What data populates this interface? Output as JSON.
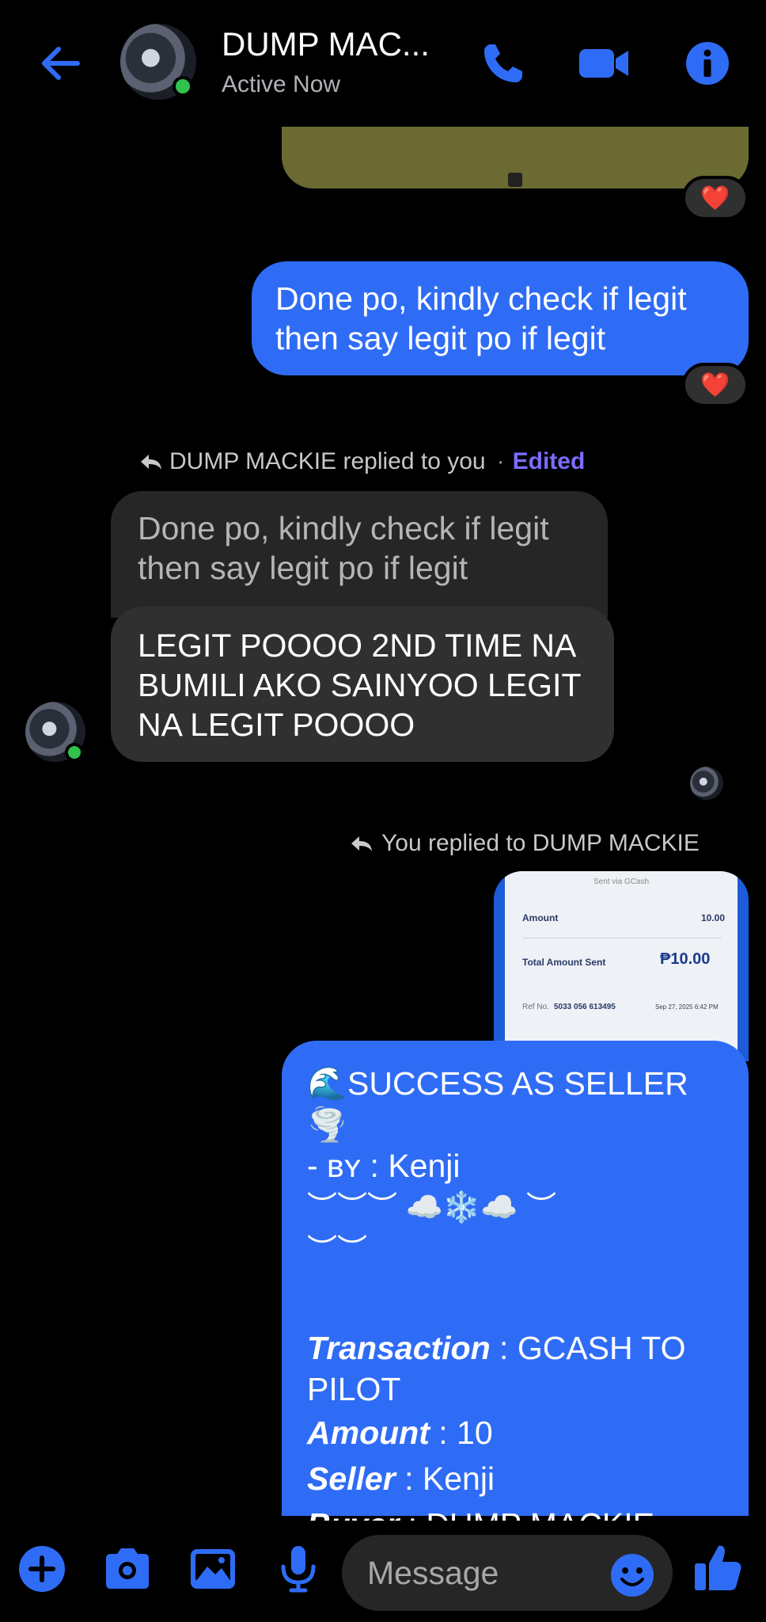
{
  "header": {
    "title": "DUMP MAC...",
    "status": "Active Now",
    "colors": {
      "accent": "#2f6cf6",
      "online": "#31c24d"
    }
  },
  "messages": {
    "sent_1": {
      "text": "Done po, kindly check if legit then say legit po if legit",
      "reaction": "❤️"
    },
    "image_1_reaction": "❤️",
    "reply_meta": {
      "text": "DUMP MACKIE replied to you",
      "separator": "·",
      "edited": "Edited"
    },
    "quoted": "Done po, kindly check if legit then say legit po if legit",
    "received_1": "LEGIT POOOO 2ND TIME NA BUMILI AKO SAINYOO LEGIT NA LEGIT POOOO",
    "reply_meta_2": "You replied to DUMP MACKIE",
    "receipt": {
      "header": "Sent via GCash",
      "amount_label": "Amount",
      "amount_value": "10.00",
      "total_label": "Total Amount Sent",
      "total_value": "₱10.00",
      "ref_label": "Ref No.",
      "ref_value": "5033 056 613495",
      "date": "Sep 27, 2025 6:42 PM"
    },
    "success": {
      "line1": "🌊SUCCESS AS SELLER🌪️",
      "line2_prefix": "- ʙʏ : ",
      "line2_name": "Kenji",
      "line3": "︶︶︶ ☁️❄️☁️ ︶",
      "line4": "︶︶",
      "transaction_label": "Transaction",
      "transaction_value": " : GCASH TO PILOT",
      "amount_label": "Amount",
      "amount_value": " : 10",
      "seller_label": "Seller",
      "seller_value": " : Kenji",
      "buyer_label": "Buyer",
      "buyer_value": " : DUMP MACKIE"
    }
  },
  "composer": {
    "placeholder": "Message"
  }
}
